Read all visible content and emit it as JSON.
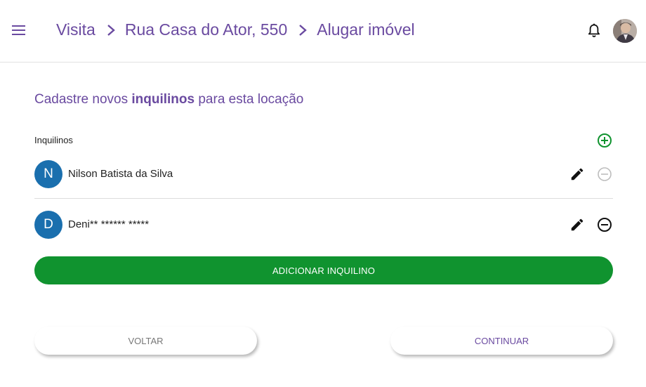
{
  "header": {
    "breadcrumb": [
      {
        "label": "Visita"
      },
      {
        "label": "Rua Casa do Ator, 550"
      },
      {
        "label": "Alugar imóvel"
      }
    ],
    "icons": {
      "menu": "menu-icon",
      "separator": "chevron-right-icon",
      "notifications": "bell-icon",
      "profile": "user-avatar"
    }
  },
  "main": {
    "title_prefix": "Cadastre novos ",
    "title_highlight": "inquilinos",
    "title_suffix": " para esta locação",
    "section_label": "Inquilinos",
    "tenants": [
      {
        "initial": "N",
        "name": "Nilson Batista da Silva",
        "remove_enabled": false
      },
      {
        "initial": "D",
        "name": "Deni** ****** *****",
        "remove_enabled": true
      }
    ],
    "add_tenant_label": "ADICIONAR INQUILINO",
    "back_label": "VOLTAR",
    "continue_label": "CONTINUAR"
  },
  "colors": {
    "accent_purple": "#6a4aa0",
    "primary_green": "#10932f",
    "avatar_blue": "#1a6fae",
    "disabled_gray": "#bdbdbd"
  }
}
